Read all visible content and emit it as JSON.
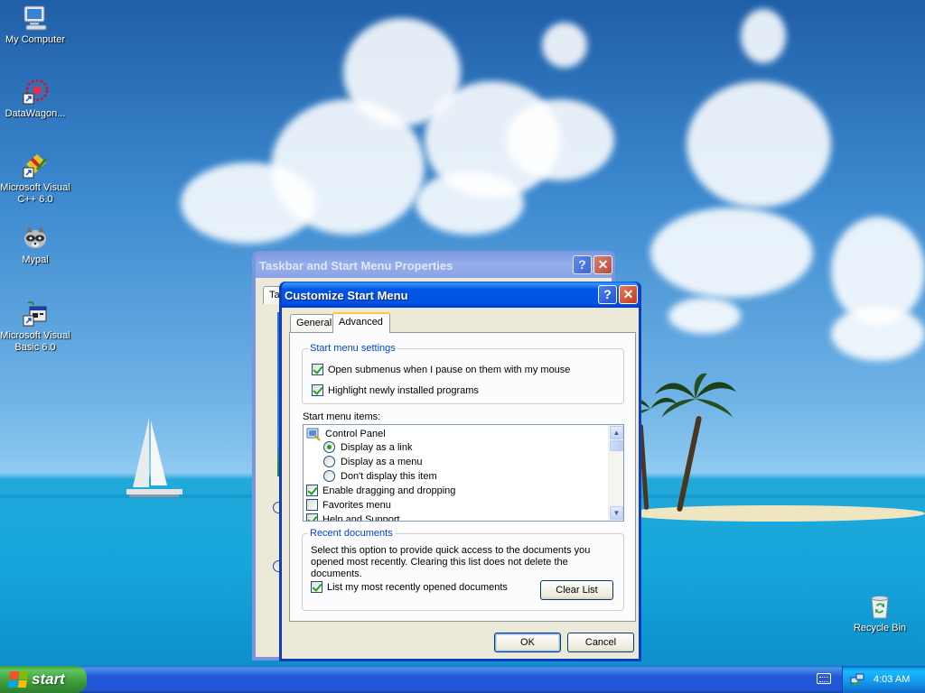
{
  "desktop": {
    "icons": [
      {
        "label": "My Computer"
      },
      {
        "label": "DataWagon..."
      },
      {
        "label": "Microsoft Visual C++ 6.0"
      },
      {
        "label": "Mypal"
      },
      {
        "label": "Microsoft Visual Basic 6.0"
      },
      {
        "label": "Recycle Bin"
      }
    ]
  },
  "back_window": {
    "title": "Taskbar and Start Menu Properties",
    "tab_partial": "Ta"
  },
  "dialog": {
    "title": "Customize Start Menu",
    "help_glyph": "?",
    "close_glyph": "✕",
    "tabs": [
      {
        "label": "General",
        "active": false
      },
      {
        "label": "Advanced",
        "active": true
      }
    ],
    "settings_group": {
      "label": "Start menu settings",
      "options": [
        {
          "label": "Open submenus when I pause on them with my mouse",
          "checked": true
        },
        {
          "label": "Highlight newly installed programs",
          "checked": true
        }
      ]
    },
    "items_label": "Start menu items:",
    "items": {
      "control_panel": "Control Panel",
      "radio_link": "Display as a link",
      "radio_menu": "Display as a menu",
      "radio_none": "Don't display this item",
      "drag_drop": "Enable dragging and dropping",
      "favorites": "Favorites menu",
      "help_support": "Help and Support"
    },
    "recent_group": {
      "label": "Recent documents",
      "description": "Select this option to provide quick access to the documents you opened most recently.  Clearing this list does not delete the documents.",
      "checkbox_label": "List my most recently opened documents",
      "clear_button": "Clear List"
    },
    "ok_button": "OK",
    "cancel_button": "Cancel"
  },
  "taskbar": {
    "start_label": "start",
    "clock": "4:03 AM"
  },
  "colors": {
    "xp_blue": "#0055e5",
    "start_green": "#3b9b3b",
    "group_label_blue": "#0046d5",
    "dialog_face": "#ece9d8"
  }
}
